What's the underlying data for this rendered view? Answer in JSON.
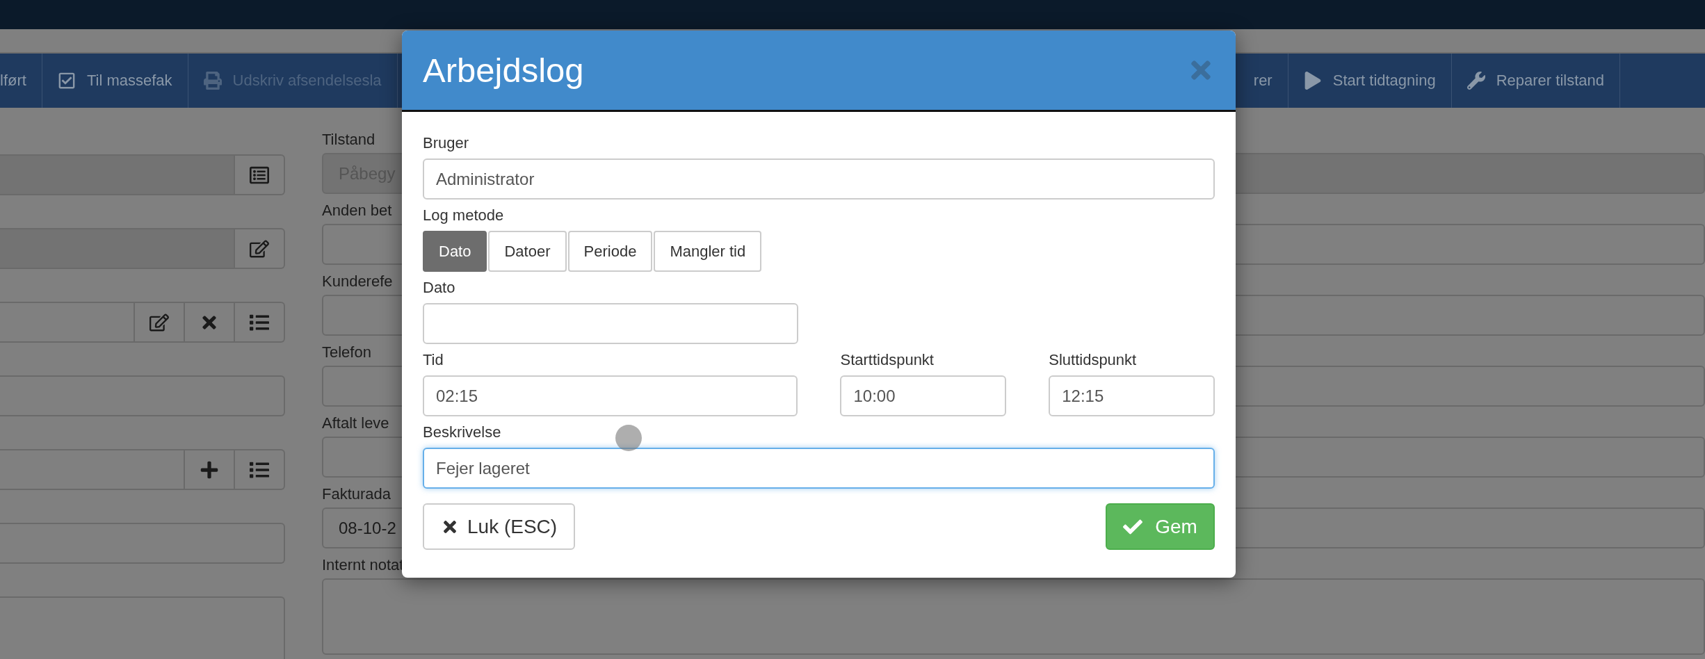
{
  "toolbar": {
    "items": [
      {
        "label": "lført",
        "disabled": false
      },
      {
        "label": "Til massefak",
        "disabled": false
      },
      {
        "label": "Udskriv afsendelsesla",
        "disabled": true
      },
      {
        "label": "rer",
        "disabled": false
      },
      {
        "label": "Start tidtagning",
        "disabled": false
      },
      {
        "label": "Reparer tilstand",
        "disabled": false
      }
    ]
  },
  "left_fields": [
    {
      "readonly": true,
      "kind": "input"
    },
    {
      "readonly": true,
      "kind": "input"
    },
    {
      "readonly": false,
      "kind": "input"
    },
    {
      "readonly": false,
      "kind": "input"
    },
    {
      "readonly": false,
      "kind": "input"
    },
    {
      "readonly": false,
      "kind": "input"
    },
    {
      "readonly": false,
      "kind": "textarea"
    }
  ],
  "right_fields": [
    {
      "label": "Tilstand",
      "value": "Påbegy",
      "readonly": true,
      "kind": "input"
    },
    {
      "label": "Anden bet",
      "readonly": false,
      "kind": "input"
    },
    {
      "label": "Kunderefe",
      "readonly": false,
      "kind": "input"
    },
    {
      "label": "Telefon",
      "readonly": false,
      "kind": "input"
    },
    {
      "label": "Aftalt leve",
      "readonly": false,
      "kind": "input"
    },
    {
      "label": "Fakturada",
      "value": "08-10-2",
      "readonly": false,
      "kind": "input"
    },
    {
      "label": "Internt notat",
      "readonly": false,
      "kind": "textarea"
    }
  ],
  "dialog": {
    "title": "Arbejdslog",
    "user": {
      "label": "Bruger",
      "value": "Administrator"
    },
    "log_method": {
      "label": "Log metode",
      "options": [
        {
          "label": "Dato",
          "selected": true
        },
        {
          "label": "Datoer",
          "selected": false
        },
        {
          "label": "Periode",
          "selected": false
        },
        {
          "label": "Mangler tid",
          "selected": false
        }
      ]
    },
    "date": {
      "label": "Dato"
    },
    "time": {
      "label": "Tid",
      "value": "02:15"
    },
    "start": {
      "label": "Starttidspunkt",
      "value": "10:00"
    },
    "end": {
      "label": "Sluttidspunkt",
      "value": "12:15"
    },
    "description": {
      "label": "Beskrivelse",
      "value": "Fejer lageret",
      "focused": true
    },
    "close_button": "Luk (ESC)",
    "save_button": "Gem"
  }
}
